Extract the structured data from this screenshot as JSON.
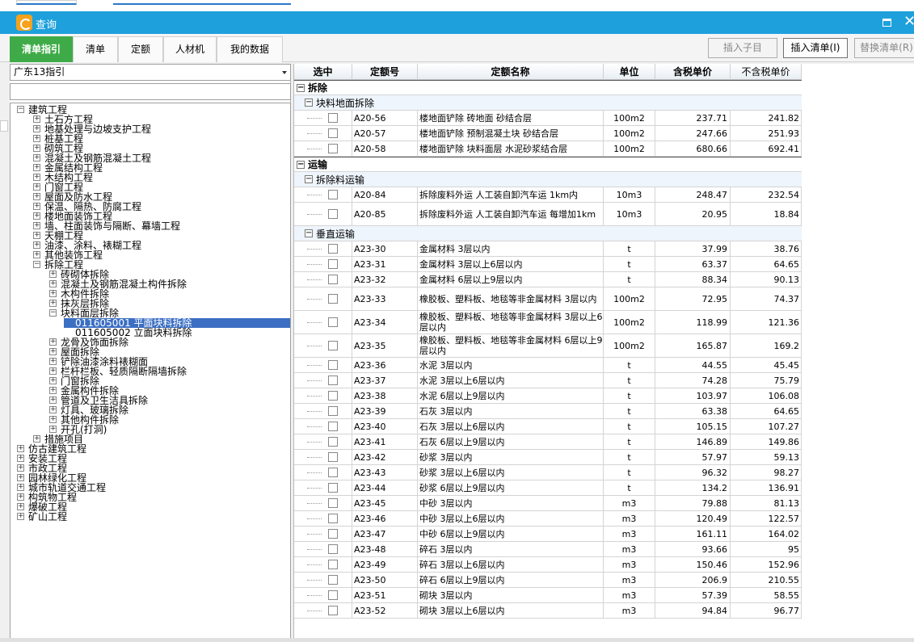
{
  "window": {
    "title": "查询"
  },
  "tabs": [
    {
      "label": "清单指引",
      "active": true
    },
    {
      "label": "清单",
      "active": false
    },
    {
      "label": "定额",
      "active": false
    },
    {
      "label": "人材机",
      "active": false
    },
    {
      "label": "我的数据",
      "active": false
    }
  ],
  "toolbar": {
    "insert_child_label": "插入子目",
    "insert_list_label": "插入清单(I)",
    "replace_list_label": "替换清单(R)"
  },
  "guide_select": {
    "value": "广东13指引"
  },
  "tree": [
    {
      "label": "建筑工程",
      "toggle": "−",
      "level": 0
    },
    {
      "label": "土石方工程",
      "toggle": "+",
      "level": 1
    },
    {
      "label": "地基处理与边坡支护工程",
      "toggle": "+",
      "level": 1
    },
    {
      "label": "桩基工程",
      "toggle": "+",
      "level": 1
    },
    {
      "label": "砌筑工程",
      "toggle": "+",
      "level": 1
    },
    {
      "label": "混凝土及钢筋混凝土工程",
      "toggle": "+",
      "level": 1
    },
    {
      "label": "金属结构工程",
      "toggle": "+",
      "level": 1
    },
    {
      "label": "木结构工程",
      "toggle": "+",
      "level": 1
    },
    {
      "label": "门窗工程",
      "toggle": "+",
      "level": 1
    },
    {
      "label": "屋面及防水工程",
      "toggle": "+",
      "level": 1
    },
    {
      "label": "保温、隔热、防腐工程",
      "toggle": "+",
      "level": 1
    },
    {
      "label": "楼地面装饰工程",
      "toggle": "+",
      "level": 1
    },
    {
      "label": "墙、柱面装饰与隔断、幕墙工程",
      "toggle": "+",
      "level": 1
    },
    {
      "label": "天棚工程",
      "toggle": "+",
      "level": 1
    },
    {
      "label": "油漆、涂料、裱糊工程",
      "toggle": "+",
      "level": 1
    },
    {
      "label": "其他装饰工程",
      "toggle": "+",
      "level": 1
    },
    {
      "label": "拆除工程",
      "toggle": "−",
      "level": 1
    },
    {
      "label": "砖砌体拆除",
      "toggle": "+",
      "level": 2
    },
    {
      "label": "混凝土及钢筋混凝土构件拆除",
      "toggle": "+",
      "level": 2
    },
    {
      "label": "木构件拆除",
      "toggle": "+",
      "level": 2
    },
    {
      "label": "抹灰层拆除",
      "toggle": "+",
      "level": 2
    },
    {
      "label": "块料面层拆除",
      "toggle": "−",
      "level": 2
    },
    {
      "label": "011605001  平面块料拆除",
      "toggle": "",
      "level": 3,
      "selected": true
    },
    {
      "label": "011605002  立面块料拆除",
      "toggle": "",
      "level": 3
    },
    {
      "label": "龙骨及饰面拆除",
      "toggle": "+",
      "level": 2
    },
    {
      "label": "屋面拆除",
      "toggle": "+",
      "level": 2
    },
    {
      "label": "铲除油漆涂料裱糊面",
      "toggle": "+",
      "level": 2
    },
    {
      "label": "栏杆栏板、轻质隔断隔墙拆除",
      "toggle": "+",
      "level": 2
    },
    {
      "label": "门窗拆除",
      "toggle": "+",
      "level": 2
    },
    {
      "label": "金属构件拆除",
      "toggle": "+",
      "level": 2
    },
    {
      "label": "管道及卫生洁具拆除",
      "toggle": "+",
      "level": 2
    },
    {
      "label": "灯具、玻璃拆除",
      "toggle": "+",
      "level": 2
    },
    {
      "label": "其他构件拆除",
      "toggle": "+",
      "level": 2
    },
    {
      "label": "开孔(打洞)",
      "toggle": "+",
      "level": 2
    },
    {
      "label": "措施项目",
      "toggle": "+",
      "level": 1
    },
    {
      "label": "仿古建筑工程",
      "toggle": "+",
      "level": 0
    },
    {
      "label": "安装工程",
      "toggle": "+",
      "level": 0
    },
    {
      "label": "市政工程",
      "toggle": "+",
      "level": 0
    },
    {
      "label": "园林绿化工程",
      "toggle": "+",
      "level": 0
    },
    {
      "label": "城市轨道交通工程",
      "toggle": "+",
      "level": 0
    },
    {
      "label": "构筑物工程",
      "toggle": "+",
      "level": 0
    },
    {
      "label": "爆破工程",
      "toggle": "+",
      "level": 0
    },
    {
      "label": "矿山工程",
      "toggle": "+",
      "level": 0
    }
  ],
  "grid": {
    "columns": [
      "选中",
      "定额号",
      "定额名称",
      "单位",
      "含税单价",
      "不含税单价"
    ],
    "rows": [
      {
        "type": "group",
        "label": "拆除"
      },
      {
        "type": "sub",
        "label": "块料地面拆除"
      },
      {
        "type": "item",
        "code": "A20-56",
        "name": "楼地面铲除 砖地面 砂结合层",
        "unit": "100m2",
        "p1": "237.71",
        "p2": "241.82"
      },
      {
        "type": "item",
        "code": "A20-57",
        "name": "楼地面铲除 预制混凝土块 砂结合层",
        "unit": "100m2",
        "p1": "247.66",
        "p2": "251.93"
      },
      {
        "type": "item",
        "code": "A20-58",
        "name": "楼地面铲除 块料面层 水泥砂浆结合层",
        "unit": "100m2",
        "p1": "680.66",
        "p2": "692.41"
      },
      {
        "type": "group",
        "label": "运输"
      },
      {
        "type": "sub",
        "label": "拆除料运输"
      },
      {
        "type": "item",
        "code": "A20-84",
        "name": "拆除废料外运 人工装自卸汽车运 1km内",
        "unit": "10m3",
        "p1": "248.47",
        "p2": "232.54"
      },
      {
        "type": "item",
        "code": "A20-85",
        "name": "拆除废料外运 人工装自卸汽车运 每增加1km",
        "unit": "10m3",
        "p1": "20.95",
        "p2": "18.84",
        "tall": true
      },
      {
        "type": "sub",
        "label": "垂直运输"
      },
      {
        "type": "item",
        "code": "A23-30",
        "name": "金属材料 3层以内",
        "unit": "t",
        "p1": "37.99",
        "p2": "38.76"
      },
      {
        "type": "item",
        "code": "A23-31",
        "name": "金属材料 3层以上6层以内",
        "unit": "t",
        "p1": "63.37",
        "p2": "64.65"
      },
      {
        "type": "item",
        "code": "A23-32",
        "name": "金属材料 6层以上9层以内",
        "unit": "t",
        "p1": "88.34",
        "p2": "90.13"
      },
      {
        "type": "item",
        "code": "A23-33",
        "name": "橡胶板、塑料板、地毯等非金属材料 3层以内",
        "unit": "100m2",
        "p1": "72.95",
        "p2": "74.37",
        "tall": true
      },
      {
        "type": "item",
        "code": "A23-34",
        "name": "橡胶板、塑料板、地毯等非金属材料 3层以上6层以内",
        "unit": "100m2",
        "p1": "118.99",
        "p2": "121.36",
        "tall": true
      },
      {
        "type": "item",
        "code": "A23-35",
        "name": "橡胶板、塑料板、地毯等非金属材料 6层以上9层以内",
        "unit": "100m2",
        "p1": "165.87",
        "p2": "169.2",
        "tall": true
      },
      {
        "type": "item",
        "code": "A23-36",
        "name": "水泥 3层以内",
        "unit": "t",
        "p1": "44.55",
        "p2": "45.45"
      },
      {
        "type": "item",
        "code": "A23-37",
        "name": "水泥 3层以上6层以内",
        "unit": "t",
        "p1": "74.28",
        "p2": "75.79"
      },
      {
        "type": "item",
        "code": "A23-38",
        "name": "水泥 6层以上9层以内",
        "unit": "t",
        "p1": "103.97",
        "p2": "106.08"
      },
      {
        "type": "item",
        "code": "A23-39",
        "name": "石灰 3层以内",
        "unit": "t",
        "p1": "63.38",
        "p2": "64.65"
      },
      {
        "type": "item",
        "code": "A23-40",
        "name": "石灰 3层以上6层以内",
        "unit": "t",
        "p1": "105.15",
        "p2": "107.27"
      },
      {
        "type": "item",
        "code": "A23-41",
        "name": "石灰 6层以上9层以内",
        "unit": "t",
        "p1": "146.89",
        "p2": "149.86"
      },
      {
        "type": "item",
        "code": "A23-42",
        "name": "砂浆 3层以内",
        "unit": "t",
        "p1": "57.97",
        "p2": "59.13"
      },
      {
        "type": "item",
        "code": "A23-43",
        "name": "砂浆 3层以上6层以内",
        "unit": "t",
        "p1": "96.32",
        "p2": "98.27"
      },
      {
        "type": "item",
        "code": "A23-44",
        "name": "砂浆 6层以上9层以内",
        "unit": "t",
        "p1": "134.2",
        "p2": "136.91"
      },
      {
        "type": "item",
        "code": "A23-45",
        "name": "中砂 3层以内",
        "unit": "m3",
        "p1": "79.88",
        "p2": "81.13"
      },
      {
        "type": "item",
        "code": "A23-46",
        "name": "中砂 3层以上6层以内",
        "unit": "m3",
        "p1": "120.49",
        "p2": "122.57"
      },
      {
        "type": "item",
        "code": "A23-47",
        "name": "中砂 6层以上9层以内",
        "unit": "m3",
        "p1": "161.11",
        "p2": "164.02"
      },
      {
        "type": "item",
        "code": "A23-48",
        "name": "碎石 3层以内",
        "unit": "m3",
        "p1": "93.66",
        "p2": "95"
      },
      {
        "type": "item",
        "code": "A23-49",
        "name": "碎石 3层以上6层以内",
        "unit": "m3",
        "p1": "150.46",
        "p2": "152.96"
      },
      {
        "type": "item",
        "code": "A23-50",
        "name": "碎石 6层以上9层以内",
        "unit": "m3",
        "p1": "206.9",
        "p2": "210.55"
      },
      {
        "type": "item",
        "code": "A23-51",
        "name": "砌块 3层以内",
        "unit": "m3",
        "p1": "57.39",
        "p2": "58.55"
      },
      {
        "type": "item",
        "code": "A23-52",
        "name": "砌块 3层以上6层以内",
        "unit": "m3",
        "p1": "94.84",
        "p2": "96.77"
      }
    ]
  }
}
